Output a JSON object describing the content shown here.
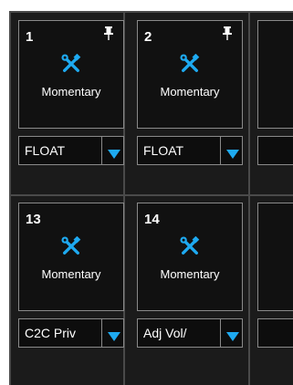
{
  "tiles": [
    {
      "number": "1",
      "mode": "Momentary",
      "pinned": true,
      "dropdown_value": "FLOAT"
    },
    {
      "number": "2",
      "mode": "Momentary",
      "pinned": true,
      "dropdown_value": "FLOAT"
    },
    {
      "number": "13",
      "mode": "Momentary",
      "pinned": false,
      "dropdown_value": "C2C Priv"
    },
    {
      "number": "14",
      "mode": "Momentary",
      "pinned": false,
      "dropdown_value": "Adj Vol/"
    }
  ],
  "icons": {
    "tool": "wrench-screwdriver-icon",
    "pin": "pin-icon",
    "dropdown": "triangle-down-icon"
  },
  "colors": {
    "accent": "#1eaaf1",
    "background": "#1b1b1b",
    "tile_border": "#8a8a8a",
    "grid_line": "#4a4a4a"
  }
}
